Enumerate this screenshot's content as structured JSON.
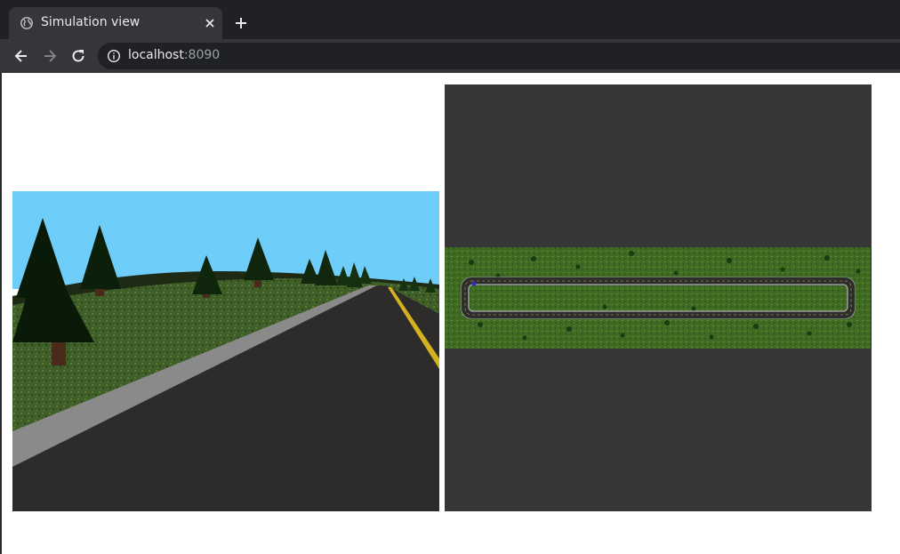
{
  "browser": {
    "tab": {
      "title": "Simulation view",
      "icon": "globe-icon"
    },
    "new_tab_icon": "plus-icon",
    "nav": {
      "back_icon": "arrow-left-icon",
      "forward_icon": "arrow-right-icon",
      "reload_icon": "reload-icon"
    },
    "address": {
      "host": "localhost",
      "port": ":8090",
      "icon": "info-icon"
    }
  },
  "views": {
    "camera": {
      "icon": "first-person-camera-view"
    },
    "map": {
      "icon": "top-down-track-map"
    }
  },
  "colors": {
    "sky": "#6fcdf9",
    "grass": "#3f5d26",
    "road": "#2d2c2a",
    "map_bg": "#363636",
    "chrome_dark": "#202124",
    "chrome_mid": "#35363a"
  }
}
